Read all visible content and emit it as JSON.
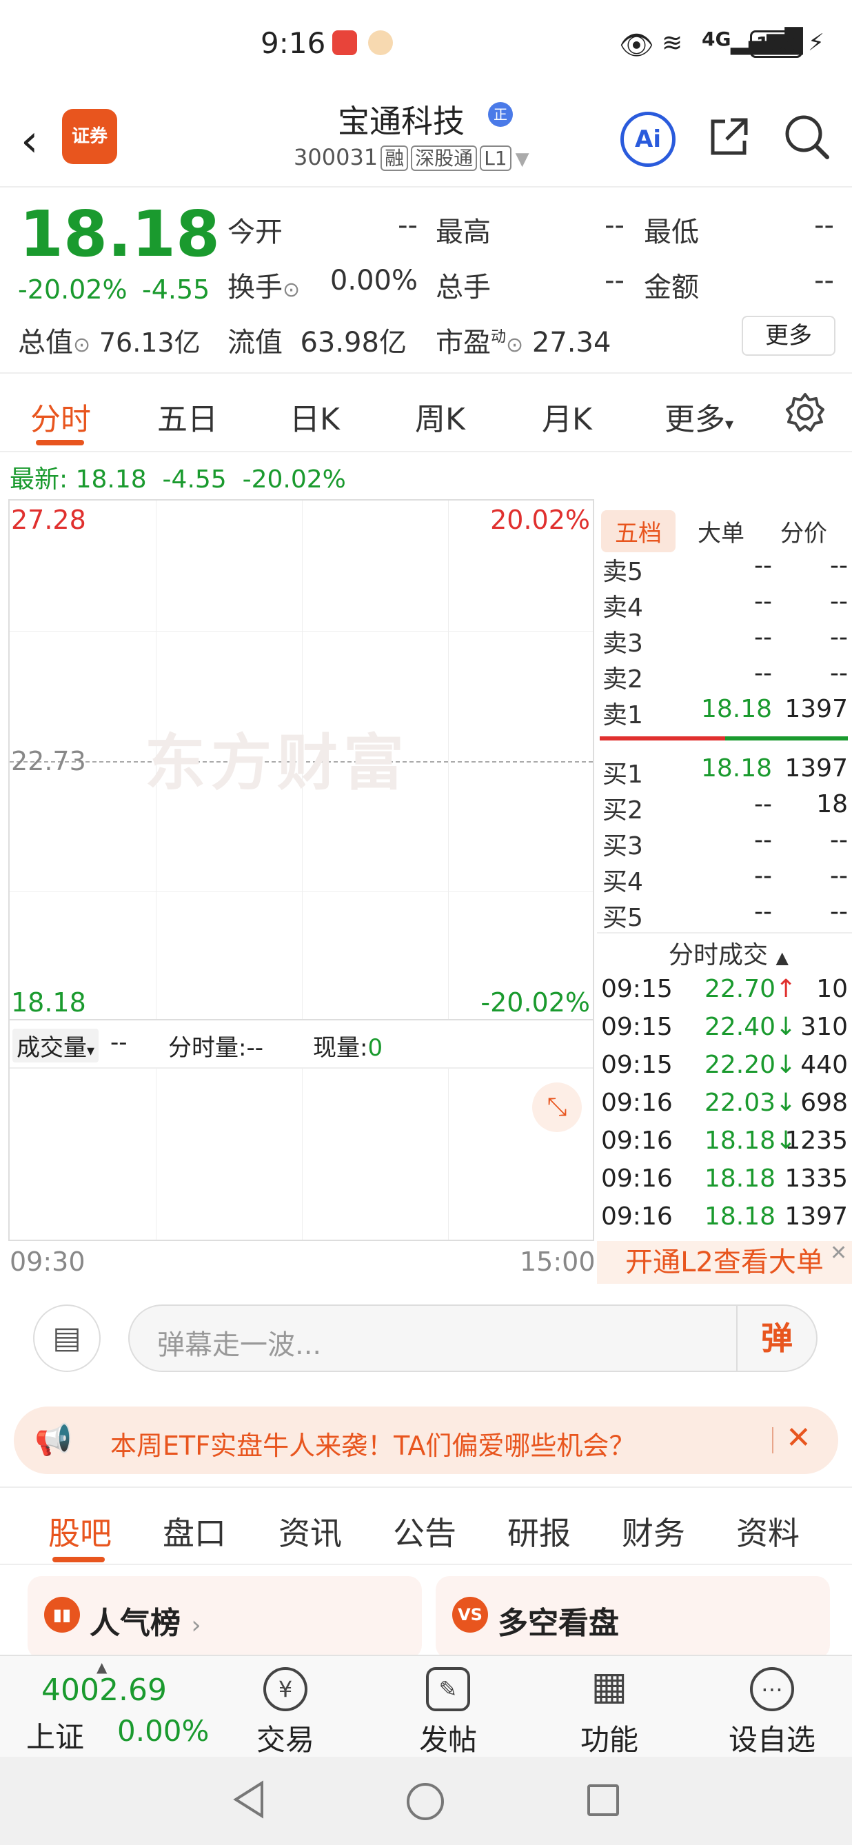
{
  "status_bar": {
    "time": "9:16",
    "network": "4G",
    "battery": "100"
  },
  "header": {
    "brand_label": "证券",
    "stock_name": "宝通科技",
    "badge": "正",
    "code": "300031",
    "tags": [
      "融",
      "深股通",
      "L1"
    ],
    "ai_label": "Ai"
  },
  "quote": {
    "price": "18.18",
    "change_pct": "-20.02%",
    "change": "-4.55",
    "fields": [
      {
        "label": "今开",
        "value": "--"
      },
      {
        "label": "最高",
        "value": "--"
      },
      {
        "label": "最低",
        "value": "--"
      },
      {
        "label": "换手",
        "value": "0.00%"
      },
      {
        "label": "总手",
        "value": "--"
      },
      {
        "label": "金额",
        "value": "--"
      }
    ],
    "total_value_label": "总值",
    "total_value": "76.13亿",
    "float_value_label": "流值",
    "float_value": "63.98亿",
    "pe_label": "市盈",
    "pe_superscript": "动",
    "pe_value": "27.34",
    "more_button": "更多"
  },
  "chart_tabs": [
    {
      "label": "分时",
      "active": true
    },
    {
      "label": "五日"
    },
    {
      "label": "日K"
    },
    {
      "label": "周K"
    },
    {
      "label": "月K"
    },
    {
      "label": "更多"
    }
  ],
  "latest": {
    "prefix": "最新:",
    "price": "18.18",
    "change": "-4.55",
    "pct": "-20.02%"
  },
  "chart": {
    "high_price": "27.28",
    "high_pct": "20.02%",
    "mid_price": "22.73",
    "low_price": "18.18",
    "low_pct": "-20.02%",
    "watermark": "东方财富",
    "time_start": "09:30",
    "time_end": "15:00"
  },
  "volume": {
    "selector": "成交量",
    "selector_value": "--",
    "fs_label": "分时量:",
    "fs_value": "--",
    "now_label": "现量:",
    "now_value": "0"
  },
  "order_book": {
    "tabs": [
      {
        "label": "五档",
        "active": true
      },
      {
        "label": "大单"
      },
      {
        "label": "分价"
      }
    ],
    "sells": [
      {
        "label": "卖5",
        "price": "--",
        "vol": "--"
      },
      {
        "label": "卖4",
        "price": "--",
        "vol": "--"
      },
      {
        "label": "卖3",
        "price": "--",
        "vol": "--"
      },
      {
        "label": "卖2",
        "price": "--",
        "vol": "--"
      },
      {
        "label": "卖1",
        "price": "18.18",
        "vol": "1397"
      }
    ],
    "buys": [
      {
        "label": "买1",
        "price": "18.18",
        "vol": "1397"
      },
      {
        "label": "买2",
        "price": "--",
        "vol": "18"
      },
      {
        "label": "买3",
        "price": "--",
        "vol": "--"
      },
      {
        "label": "买4",
        "price": "--",
        "vol": "--"
      },
      {
        "label": "买5",
        "price": "--",
        "vol": "--"
      }
    ],
    "trades_header": "分时成交",
    "trades": [
      {
        "time": "09:15",
        "price": "22.70↑",
        "vol": "10",
        "dir": "up"
      },
      {
        "time": "09:15",
        "price": "22.40↓",
        "vol": "310",
        "dir": "down"
      },
      {
        "time": "09:15",
        "price": "22.20↓",
        "vol": "440",
        "dir": "down"
      },
      {
        "time": "09:16",
        "price": "22.03↓",
        "vol": "698",
        "dir": "down"
      },
      {
        "time": "09:16",
        "price": "18.18↓",
        "vol": "1235",
        "dir": "down"
      },
      {
        "time": "09:16",
        "price": "18.18",
        "vol": "1335",
        "dir": "none"
      },
      {
        "time": "09:16",
        "price": "18.18",
        "vol": "1397",
        "dir": "none"
      }
    ],
    "l2_banner": "开通L2查看大单"
  },
  "danmu": {
    "placeholder": "弹幕走一波...",
    "send_label": "弹"
  },
  "banner": {
    "text": "本周ETF实盘牛人来袭！TA们偏爱哪些机会？"
  },
  "content_tabs": [
    {
      "label": "股吧",
      "active": true
    },
    {
      "label": "盘口"
    },
    {
      "label": "资讯"
    },
    {
      "label": "公告"
    },
    {
      "label": "研报"
    },
    {
      "label": "财务"
    },
    {
      "label": "资料"
    }
  ],
  "cards": [
    {
      "title": "人气榜"
    },
    {
      "title": "多空看盘",
      "icon": "VS"
    }
  ],
  "bottom_nav": {
    "index_value": "4002.69",
    "index_name": "上证",
    "index_pct": "0.00%",
    "items": [
      {
        "label": "交易",
        "icon": "¥"
      },
      {
        "label": "发帖",
        "icon": "✎"
      },
      {
        "label": "功能",
        "icon": "▦"
      },
      {
        "label": "设自选",
        "icon": "⋯"
      }
    ]
  },
  "colors": {
    "accent": "#e8551e",
    "down": "#1a9a2e",
    "up": "#e0302e"
  }
}
